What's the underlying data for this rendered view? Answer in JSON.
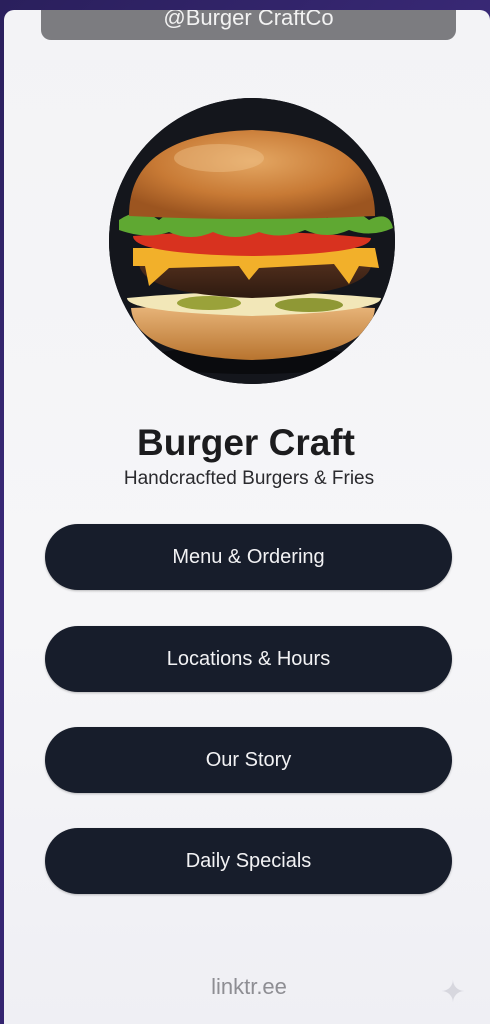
{
  "header": {
    "handle": "@Burger  CraftCo"
  },
  "profile": {
    "name": "Burger Craft",
    "tagline": "Handcracfted Burgers & Fries"
  },
  "links": [
    {
      "label": "Menu & Ordering"
    },
    {
      "label": "Locations & Hours"
    },
    {
      "label": "Our Story"
    },
    {
      "label": "Daily Specials"
    }
  ],
  "footer": {
    "brand": "linktr.ee"
  },
  "colors": {
    "button_bg": "#171d2b",
    "card_bg": "#f4f4f7",
    "page_bg": "#2d1e63"
  }
}
